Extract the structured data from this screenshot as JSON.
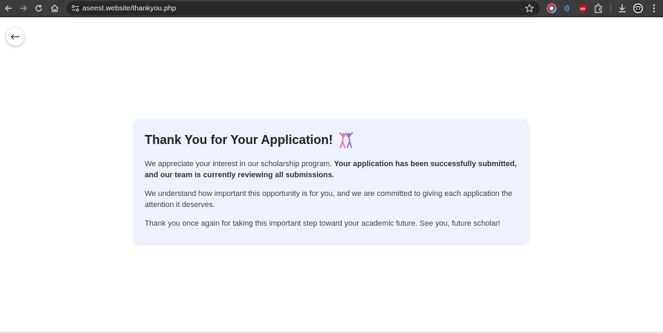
{
  "browser": {
    "url": "aseest.website/thankyou.php"
  },
  "page": {
    "heading": "Thank You for Your Application!",
    "p1_intro": "We appreciate your interest in our scholarship program. ",
    "p1_bold": "Your application has been successfully submitted, and our team is currently reviewing all submissions.",
    "p2": "We understand how important this opportunity is for you, and we are committed to giving each application the attention it deserves.",
    "p3": "Thank you once again for taking this important step toward your academic future. See you, future scholar!"
  },
  "icons": {
    "back": "arrow-left-icon",
    "celebrate": "people-celebrating-icon"
  },
  "colors": {
    "card_bg": "#eff2fd",
    "toolbar_bg": "#3c3c3c"
  }
}
